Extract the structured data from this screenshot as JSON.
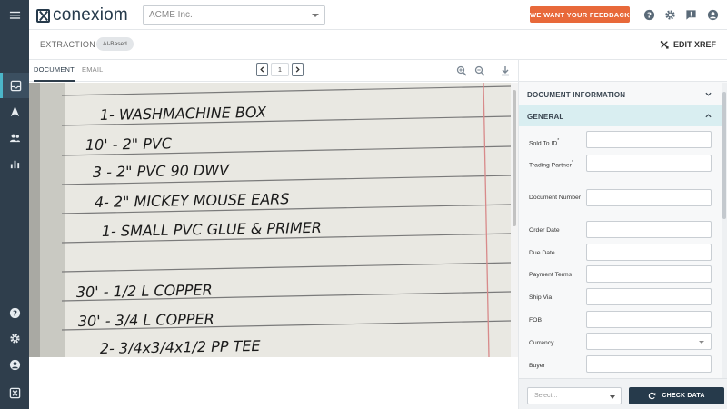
{
  "app": {
    "brand": "conexiom",
    "company": "ACME Inc."
  },
  "header": {
    "feedback_label": "WE WANT YOUR FEEDBACK",
    "icons": [
      "help-icon",
      "gear-icon",
      "chat-icon",
      "account-icon"
    ]
  },
  "rail": {
    "icons": [
      "menu-icon",
      "inbox-icon",
      "navigate-icon",
      "users-icon",
      "chart-icon",
      "help-icon",
      "gear-icon",
      "account-icon",
      "logo-icon"
    ]
  },
  "subheader": {
    "title": "EXTRACTION",
    "badge": "AI-Based",
    "edit_xref": "EDIT XREF"
  },
  "document": {
    "tabs": [
      {
        "label": "DOCUMENT",
        "active": true
      },
      {
        "label": "EMAIL",
        "active": false
      }
    ],
    "page": "1",
    "handwriting": [
      "1- WASHMACHINE BOX",
      "10' - 2\" PVC",
      "3 - 2\" PVC 90 DWV",
      "4- 2\" MICKEY MOUSE EARS",
      "1- SMALL PVC GLUE & PRIMER",
      "30' - 1/2 L COPPER",
      "30' - 3/4 L COPPER",
      "2- 3/4x3/4x1/2 PP TEE"
    ]
  },
  "panel": {
    "sections": {
      "doc_info": "DOCUMENT INFORMATION",
      "general": "GENERAL"
    },
    "fields": [
      {
        "label": "Sold To ID",
        "required": "*",
        "value": ""
      },
      {
        "label": "Trading Partner",
        "required": "*",
        "value": ""
      },
      {
        "label": "Document Number",
        "required": "",
        "value": ""
      },
      {
        "label": "Order Date",
        "required": "",
        "value": ""
      },
      {
        "label": "Due Date",
        "required": "",
        "value": ""
      },
      {
        "label": "Payment Terms",
        "required": "",
        "value": ""
      },
      {
        "label": "Ship Via",
        "required": "",
        "value": ""
      },
      {
        "label": "FOB",
        "required": "",
        "value": ""
      },
      {
        "label": "Currency",
        "required": "",
        "value": ""
      },
      {
        "label": "Buyer",
        "required": "",
        "value": ""
      }
    ],
    "bottom_select_placeholder": "Select...",
    "check_label": "CHECK DATA"
  }
}
